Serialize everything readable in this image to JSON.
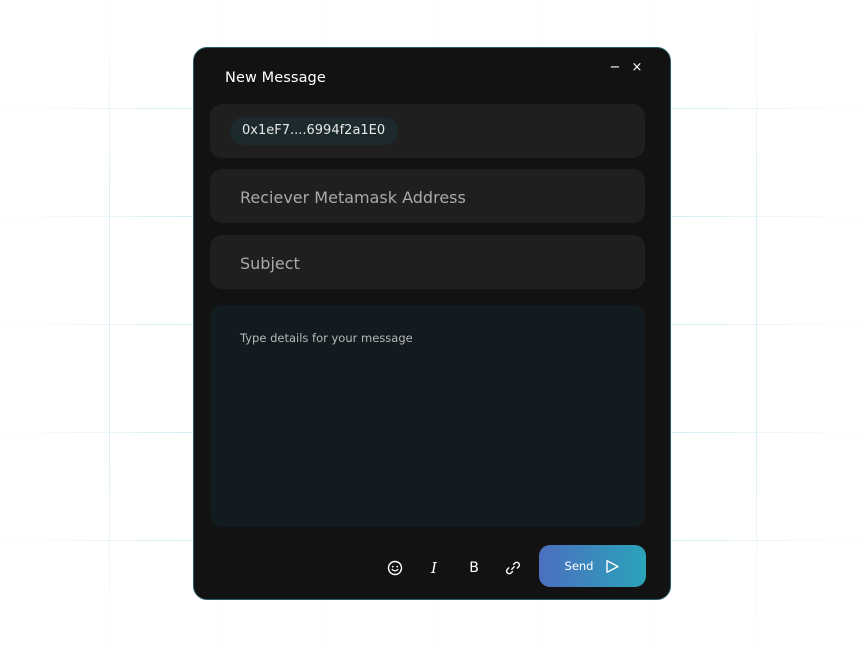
{
  "compose": {
    "title": "New Message",
    "window_controls": {
      "minimize": "−",
      "close": "×"
    },
    "sender_address": "0x1eF7....6994f2a1E0",
    "receiver": {
      "placeholder": "Reciever Metamask Address",
      "value": ""
    },
    "subject": {
      "placeholder": "Subject",
      "value": ""
    },
    "message": {
      "placeholder": "Type details for your message",
      "value": ""
    },
    "toolbar": {
      "emoji_icon": "emoji-icon",
      "italic_label": "I",
      "bold_label": "B",
      "link_icon": "link-icon"
    },
    "send_label": "Send",
    "colors": {
      "panel": "#121212",
      "field": "#1f1f1f",
      "message_area": "#121b1f",
      "send_gradient_start": "#4c6fbf",
      "send_gradient_end": "#2aa3ba",
      "border": "#2c5d6a"
    }
  }
}
